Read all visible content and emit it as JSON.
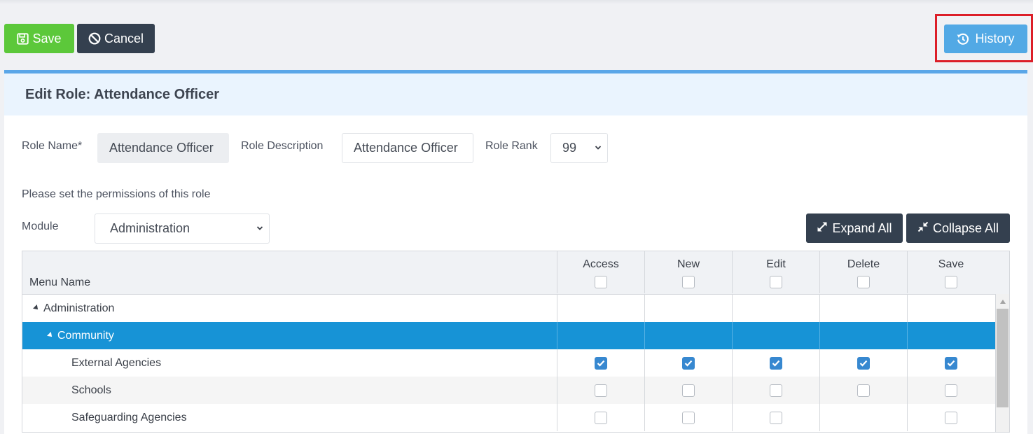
{
  "toolbar": {
    "save_label": "Save",
    "cancel_label": "Cancel",
    "history_label": "History"
  },
  "panel": {
    "title": "Edit Role: Attendance Officer"
  },
  "form": {
    "role_name_label": "Role Name*",
    "role_name_value": "Attendance Officer",
    "role_description_label": "Role Description",
    "role_description_value": "Attendance Officer",
    "role_rank_label": "Role Rank",
    "role_rank_value": "99",
    "permissions_hint": "Please set the permissions of this role",
    "module_label": "Module",
    "module_value": "Administration"
  },
  "tree_actions": {
    "expand_all": "Expand All",
    "collapse_all": "Collapse All"
  },
  "grid": {
    "menu_name_header": "Menu Name",
    "columns": [
      "Access",
      "New",
      "Edit",
      "Delete",
      "Save"
    ],
    "rows": [
      {
        "label": "Administration",
        "level": 0,
        "expandable": true,
        "selected": false,
        "checks": null
      },
      {
        "label": "Community",
        "level": 1,
        "expandable": true,
        "selected": true,
        "checks": null
      },
      {
        "label": "External Agencies",
        "level": 2,
        "expandable": false,
        "selected": false,
        "checks": [
          true,
          true,
          true,
          true,
          true
        ]
      },
      {
        "label": "Schools",
        "level": 2,
        "expandable": false,
        "selected": false,
        "checks": [
          false,
          false,
          false,
          false,
          false
        ]
      },
      {
        "label": "Safeguarding Agencies",
        "level": 2,
        "expandable": false,
        "selected": false,
        "checks": [
          false,
          false,
          false,
          null,
          false
        ]
      }
    ]
  },
  "colors": {
    "save": "#5cc83a",
    "dark": "#34404f",
    "history": "#52a9e5",
    "selected_row": "#1793d6",
    "highlight": "#dc1e28"
  },
  "icons": {
    "save": "floppy-icon",
    "cancel": "ban-icon",
    "history": "history-icon",
    "expand": "expand-icon",
    "collapse": "compress-icon"
  }
}
